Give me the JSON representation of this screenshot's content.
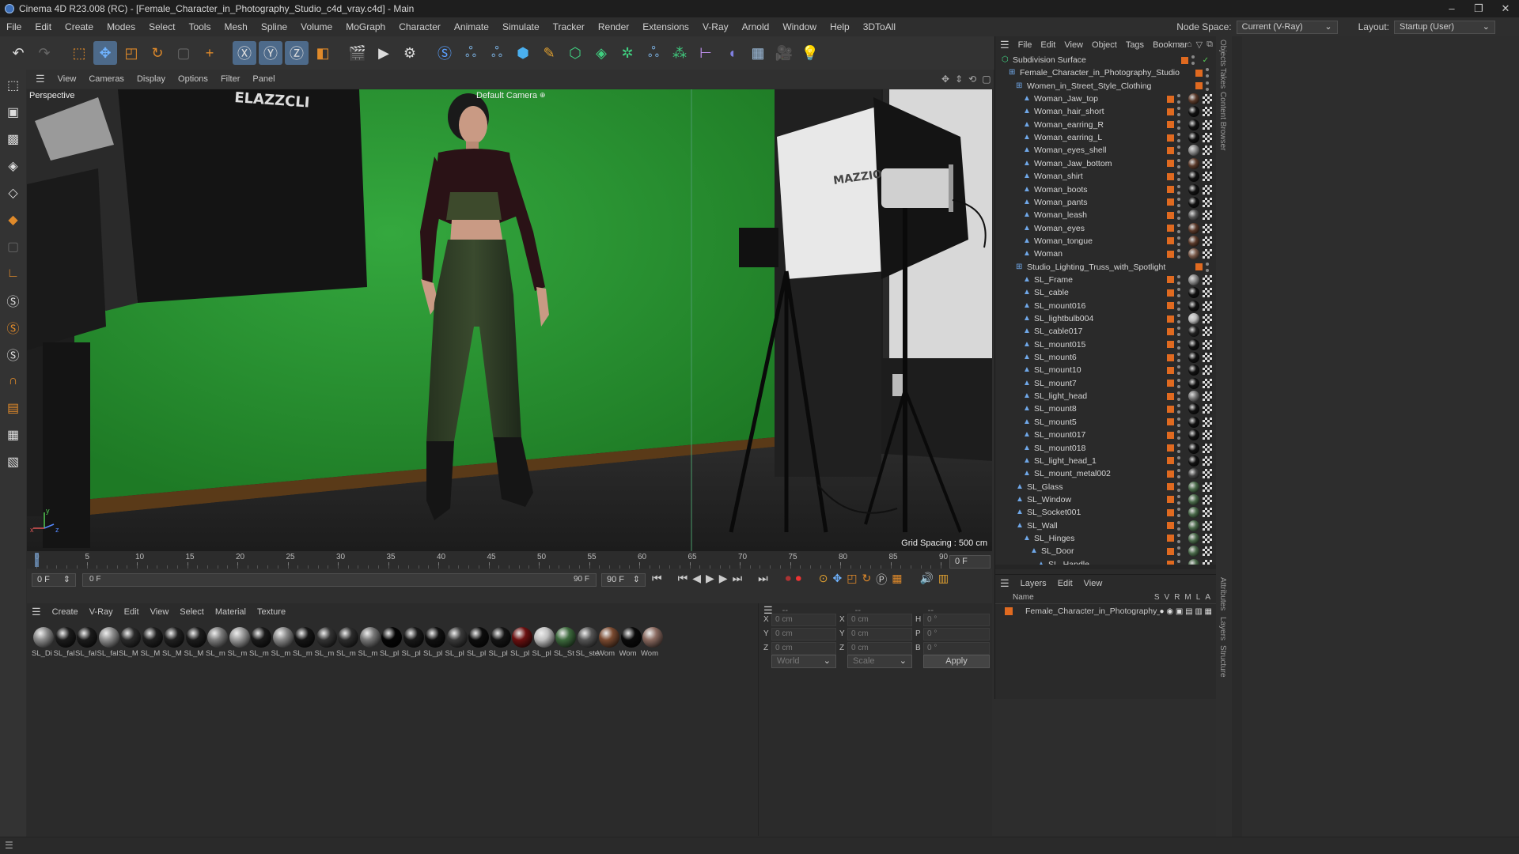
{
  "window": {
    "title": "Cinema 4D R23.008 (RC) - [Female_Character_in_Photography_Studio_c4d_vray.c4d] - Main",
    "buttons": [
      "–",
      "❐",
      "✕"
    ]
  },
  "menubar": {
    "items": [
      "File",
      "Edit",
      "Create",
      "Modes",
      "Select",
      "Tools",
      "Mesh",
      "Spline",
      "Volume",
      "MoGraph",
      "Character",
      "Animate",
      "Simulate",
      "Tracker",
      "Render",
      "Extensions",
      "V-Ray",
      "Arnold",
      "Window",
      "Help",
      "3DToAll"
    ],
    "node_space_label": "Node Space:",
    "node_space_value": "Current (V-Ray)",
    "layout_label": "Layout:",
    "layout_value": "Startup (User)"
  },
  "viewport": {
    "menu": [
      "View",
      "Cameras",
      "Display",
      "Options",
      "Filter",
      "Panel"
    ],
    "view_name": "Perspective",
    "camera_name": "Default Camera",
    "grid_spacing": "Grid Spacing : 500 cm",
    "box_text": "ELAZZCLI",
    "softbox_text": "MAZZIO",
    "axis_x": "x",
    "axis_y": "y",
    "axis_z": "z"
  },
  "timeline": {
    "ticks": [
      "0",
      "5",
      "10",
      "15",
      "20",
      "25",
      "30",
      "35",
      "40",
      "45",
      "50",
      "55",
      "60",
      "65",
      "70",
      "75",
      "80",
      "85",
      "90"
    ],
    "current_frame_right": "0 F",
    "start_field": "0 F",
    "slider_start": "0 F",
    "slider_end": "90 F",
    "end_field": "90 F"
  },
  "materials": {
    "menu": [
      "Create",
      "V-Ray",
      "Edit",
      "View",
      "Select",
      "Material",
      "Texture"
    ],
    "items": [
      {
        "label": "SL_Di",
        "tone": "#8a8a8a"
      },
      {
        "label": "SL_fal",
        "tone": "#1b1b1b"
      },
      {
        "label": "SL_fal",
        "tone": "#1b1b1b"
      },
      {
        "label": "SL_fal",
        "tone": "#8f8f8f"
      },
      {
        "label": "SL_M",
        "tone": "#2a2a2a"
      },
      {
        "label": "SL_M",
        "tone": "#1f1f1f"
      },
      {
        "label": "SL_M",
        "tone": "#202020"
      },
      {
        "label": "SL_M",
        "tone": "#1c1c1c"
      },
      {
        "label": "SL_m",
        "tone": "#7d7d7d"
      },
      {
        "label": "SL_m",
        "tone": "#9a9a9a"
      },
      {
        "label": "SL_m",
        "tone": "#1a1a1a"
      },
      {
        "label": "SL_m",
        "tone": "#888"
      },
      {
        "label": "SL_m",
        "tone": "#151515"
      },
      {
        "label": "SL_m",
        "tone": "#333"
      },
      {
        "label": "SL_m",
        "tone": "#2c2c2c"
      },
      {
        "label": "SL_m",
        "tone": "#777"
      },
      {
        "label": "SL_pl",
        "tone": "#050505"
      },
      {
        "label": "SL_pl",
        "tone": "#181818"
      },
      {
        "label": "SL_pl",
        "tone": "#101010"
      },
      {
        "label": "SL_pl",
        "tone": "#3a3a3a"
      },
      {
        "label": "SL_pl",
        "tone": "#0d0d0d"
      },
      {
        "label": "SL_pl",
        "tone": "#141414"
      },
      {
        "label": "SL_pl",
        "tone": "#6b1010"
      },
      {
        "label": "SL_pl",
        "tone": "#c0c0c0"
      },
      {
        "label": "SL_St",
        "tone": "#3d6a3d"
      },
      {
        "label": "SL_ste",
        "tone": "#555"
      },
      {
        "label": "Wom",
        "tone": "#7a4a30"
      },
      {
        "label": "Wom",
        "tone": "#0a0a0a"
      },
      {
        "label": "Wom",
        "tone": "#8a6a60"
      }
    ]
  },
  "attributes": {
    "header": "--",
    "header2": "--",
    "header3": "--",
    "rows": [
      {
        "a": "X",
        "av": "0 cm",
        "b": "X",
        "bv": "0 cm",
        "c": "H",
        "cv": "0 °"
      },
      {
        "a": "Y",
        "av": "0 cm",
        "b": "Y",
        "bv": "0 cm",
        "c": "P",
        "cv": "0 °"
      },
      {
        "a": "Z",
        "av": "0 cm",
        "b": "Z",
        "bv": "0 cm",
        "c": "B",
        "cv": "0 °"
      }
    ],
    "coord_system": "World",
    "mode": "Scale",
    "apply": "Apply"
  },
  "objects": {
    "menu": [
      "File",
      "Edit",
      "View",
      "Object",
      "Tags",
      "Bookmar"
    ],
    "tree": [
      {
        "name": "Subdivision Surface",
        "level": 0,
        "kind": "subdiv"
      },
      {
        "name": "Female_Character_in_Photography_Studio",
        "level": 1,
        "kind": "null"
      },
      {
        "name": "Women_in_Street_Style_Clothing",
        "level": 2,
        "kind": "null"
      },
      {
        "name": "Woman_Jaw_top",
        "level": 3,
        "kind": "mesh",
        "mat": "#5a3a2a"
      },
      {
        "name": "Woman_hair_short",
        "level": 3,
        "kind": "mesh",
        "mat": "#111"
      },
      {
        "name": "Woman_earring_R",
        "level": 3,
        "kind": "mesh",
        "mat": "#111"
      },
      {
        "name": "Woman_earring_L",
        "level": 3,
        "kind": "mesh",
        "mat": "#111"
      },
      {
        "name": "Woman_eyes_shell",
        "level": 3,
        "kind": "mesh",
        "mat": "#888"
      },
      {
        "name": "Woman_Jaw_bottom",
        "level": 3,
        "kind": "mesh",
        "mat": "#5a3a2a"
      },
      {
        "name": "Woman_shirt",
        "level": 3,
        "kind": "mesh",
        "mat": "#111"
      },
      {
        "name": "Woman_boots",
        "level": 3,
        "kind": "mesh",
        "mat": "#111"
      },
      {
        "name": "Woman_pants",
        "level": 3,
        "kind": "mesh",
        "mat": "#111"
      },
      {
        "name": "Woman_leash",
        "level": 3,
        "kind": "mesh",
        "mat": "#555"
      },
      {
        "name": "Woman_eyes",
        "level": 3,
        "kind": "mesh",
        "mat": "#5a3a2a"
      },
      {
        "name": "Woman_tongue",
        "level": 3,
        "kind": "mesh",
        "mat": "#5a3a2a"
      },
      {
        "name": "Woman",
        "level": 3,
        "kind": "mesh",
        "mat": "#7a5a4a"
      },
      {
        "name": "Studio_Lighting_Truss_with_Spotlight",
        "level": 2,
        "kind": "null"
      },
      {
        "name": "SL_Frame",
        "level": 3,
        "kind": "mesh",
        "mat": "#888"
      },
      {
        "name": "SL_cable",
        "level": 3,
        "kind": "mesh",
        "mat": "#111"
      },
      {
        "name": "SL_mount016",
        "level": 3,
        "kind": "mesh",
        "mat": "#111"
      },
      {
        "name": "SL_lightbulb004",
        "level": 3,
        "kind": "mesh",
        "mat": "#bbb"
      },
      {
        "name": "SL_cable017",
        "level": 3,
        "kind": "mesh",
        "mat": "#222"
      },
      {
        "name": "SL_mount015",
        "level": 3,
        "kind": "mesh",
        "mat": "#111"
      },
      {
        "name": "SL_mount6",
        "level": 3,
        "kind": "mesh",
        "mat": "#111"
      },
      {
        "name": "SL_mount10",
        "level": 3,
        "kind": "mesh",
        "mat": "#111"
      },
      {
        "name": "SL_mount7",
        "level": 3,
        "kind": "mesh",
        "mat": "#111"
      },
      {
        "name": "SL_light_head",
        "level": 3,
        "kind": "mesh",
        "mat": "#777"
      },
      {
        "name": "SL_mount8",
        "level": 3,
        "kind": "mesh",
        "mat": "#111"
      },
      {
        "name": "SL_mount5",
        "level": 3,
        "kind": "mesh",
        "mat": "#111"
      },
      {
        "name": "SL_mount017",
        "level": 3,
        "kind": "mesh",
        "mat": "#111"
      },
      {
        "name": "SL_mount018",
        "level": 3,
        "kind": "mesh",
        "mat": "#111"
      },
      {
        "name": "SL_light_head_1",
        "level": 3,
        "kind": "mesh",
        "mat": "#111"
      },
      {
        "name": "SL_mount_metal002",
        "level": 3,
        "kind": "mesh",
        "mat": "#444"
      },
      {
        "name": "SL_Glass",
        "level": 2,
        "kind": "mesh",
        "mat": "#4a6a4a"
      },
      {
        "name": "SL_Window",
        "level": 2,
        "kind": "mesh",
        "mat": "#4a6a4a"
      },
      {
        "name": "SL_Socket001",
        "level": 2,
        "kind": "mesh",
        "mat": "#4a6a4a"
      },
      {
        "name": "SL_Wall",
        "level": 2,
        "kind": "mesh",
        "mat": "#4a6a4a"
      },
      {
        "name": "SL_Hinges",
        "level": 3,
        "kind": "mesh",
        "mat": "#4a6a4a"
      },
      {
        "name": "SL_Door",
        "level": 4,
        "kind": "mesh",
        "mat": "#4a6a4a"
      },
      {
        "name": "SL_Handle",
        "level": 5,
        "kind": "mesh",
        "mat": "#4a6a4a"
      }
    ]
  },
  "layers": {
    "menu": [
      "Layers",
      "Edit",
      "View"
    ],
    "col_name": "Name",
    "cols": [
      "S",
      "V",
      "R",
      "M",
      "L",
      "A"
    ],
    "items": [
      "Female_Character_in_Photography_Studio"
    ]
  },
  "side_tabs": [
    "Objects",
    "Takes",
    "Content Browser",
    "Attributes",
    "Layers",
    "Structure"
  ]
}
